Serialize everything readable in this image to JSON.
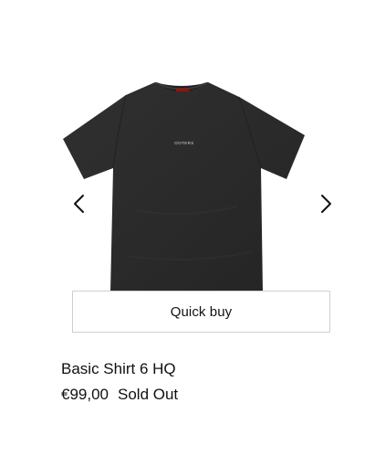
{
  "product": {
    "title": "Basic Shirt 6 HQ",
    "price": "€99,00",
    "status": "Sold Out",
    "shirt_print_text": "OOTERS",
    "shirt_color": "#2b2b2b",
    "label_color": "#7a1f1a"
  },
  "gallery": {
    "prev_icon": "chevron-left-icon",
    "next_icon": "chevron-right-icon"
  },
  "actions": {
    "quick_buy_label": "Quick buy"
  }
}
